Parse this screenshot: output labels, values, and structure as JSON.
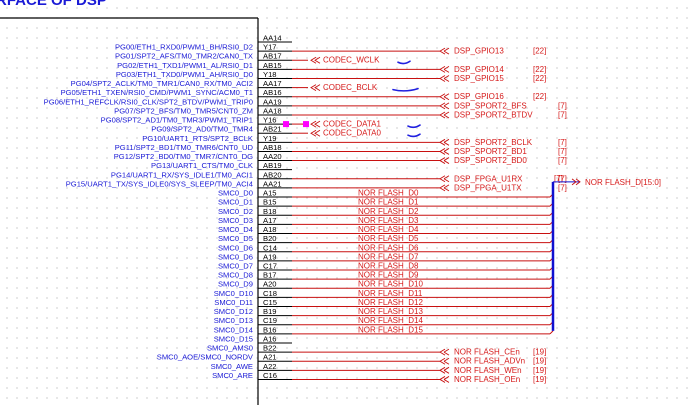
{
  "title": "RFACE OF DSP",
  "colors": {
    "pin_text": "#1a1ad6",
    "ball_text": "#000000",
    "net_text": "#d61a1a",
    "wire": "#c81010",
    "bus": "#1010d0",
    "pink_marker": "#ff00ff",
    "annotation": "#2020e0"
  },
  "pins": [
    {
      "name": "",
      "ball": "AA14",
      "net": "",
      "ref": ""
    },
    {
      "name": "PG00/ETH1_RXD0/PWM1_BH/RSI0_D2",
      "ball": "Y17",
      "net": "DSP_GPIO13",
      "ref": "[22]"
    },
    {
      "name": "PG01/SPT2_AFS/TM0_TMR2/CAN0_TX",
      "ball": "AB17",
      "net": "CODEC_WCLK",
      "ref": ""
    },
    {
      "name": "PG02/ETH1_TXD1/PWM1_AL/RSI0_D1",
      "ball": "AB15",
      "net": "DSP_GPIO14",
      "ref": "[22]"
    },
    {
      "name": "PG03/ETH1_TXD0/PWM1_AH/RSI0_D0",
      "ball": "Y18",
      "net": "DSP_GPIO15",
      "ref": "[22]"
    },
    {
      "name": "PG04/SPT2_ACLK/TM0_TMR1/CAN0_RX/TM0_ACI2",
      "ball": "AA17",
      "net": "CODEC_BCLK",
      "ref": ""
    },
    {
      "name": "PG05/ETH1_TXEN/RSI0_CMD/PWM1_SYNC/ACM0_T1",
      "ball": "AB16",
      "net": "DSP_GPIO16",
      "ref": "[22]"
    },
    {
      "name": "PG06/ETH1_REFCLK/RSI0_CLK/SPT2_BTDV/PWM1_TRIP0",
      "ball": "AA19",
      "net": "DSP_SPORT2_BFS",
      "ref": "[7]"
    },
    {
      "name": "PG07/SPT2_BFS/TM0_TMR5/CNT0_ZM",
      "ball": "AA18",
      "net": "DSP_SPORT2_BTDV",
      "ref": "[7]"
    },
    {
      "name": "PG08/SPT2_AD1/TM0_TMR3/PWM1_TRIP1",
      "ball": "Y16",
      "net": "CODEC_DATA1",
      "ref": ""
    },
    {
      "name": "PG09/SPT2_AD0/TM0_TMR4",
      "ball": "AB21",
      "net": "CODEC_DATA0",
      "ref": ""
    },
    {
      "name": "PG10/UART1_RTS/SPT2_BCLK",
      "ball": "Y19",
      "net": "DSP_SPORT2_BCLK",
      "ref": "[7]"
    },
    {
      "name": "PG11/SPT2_BD1/TM0_TMR6/CNT0_UD",
      "ball": "AB18",
      "net": "DSP_SPORT2_BD1",
      "ref": "[7]"
    },
    {
      "name": "PG12/SPT2_BD0/TM0_TMR7/CNT0_DG",
      "ball": "AA20",
      "net": "DSP_SPORT2_BD0",
      "ref": "[7]"
    },
    {
      "name": "PG13/UART1_CTS/TM0_CLK",
      "ball": "AB19",
      "net": "",
      "ref": ""
    },
    {
      "name": "PG14/UART1_RX/SYS_IDLE1/TM0_ACI1",
      "ball": "AB20",
      "net": "DSP_FPGA_U1RX",
      "ref": "[7]"
    },
    {
      "name": "PG15/UART1_TX/SYS_IDLE0/SYS_SLEEP/TM0_ACI4",
      "ball": "AA21",
      "net": "DSP_FPGA_U1TX",
      "ref": "[7]"
    },
    {
      "name": "SMC0_D0",
      "ball": "A15",
      "net": "NOR FLASH_D0",
      "ref": ""
    },
    {
      "name": "SMC0_D1",
      "ball": "B15",
      "net": "NOR FLASH_D1",
      "ref": ""
    },
    {
      "name": "SMC0_D2",
      "ball": "B18",
      "net": "NOR FLASH_D2",
      "ref": ""
    },
    {
      "name": "SMC0_D3",
      "ball": "A17",
      "net": "NOR FLASH_D3",
      "ref": ""
    },
    {
      "name": "SMC0_D4",
      "ball": "A18",
      "net": "NOR FLASH_D4",
      "ref": ""
    },
    {
      "name": "SMC0_D5",
      "ball": "B20",
      "net": "NOR FLASH_D5",
      "ref": ""
    },
    {
      "name": "SMC0_D6",
      "ball": "C14",
      "net": "NOR FLASH_D6",
      "ref": ""
    },
    {
      "name": "SMC0_D6",
      "ball": "A19",
      "net": "NOR FLASH_D7",
      "ref": ""
    },
    {
      "name": "SMC0_D7",
      "ball": "C17",
      "net": "NOR FLASH_D8",
      "ref": ""
    },
    {
      "name": "SMC0_D8",
      "ball": "B17",
      "net": "NOR FLASH_D9",
      "ref": ""
    },
    {
      "name": "SMC0_D9",
      "ball": "A20",
      "net": "NOR FLASH_D10",
      "ref": ""
    },
    {
      "name": "SMC0_D10",
      "ball": "C18",
      "net": "NOR FLASH_D11",
      "ref": ""
    },
    {
      "name": "SMC0_D11",
      "ball": "C15",
      "net": "NOR FLASH_D12",
      "ref": ""
    },
    {
      "name": "SMC0_D12",
      "ball": "B19",
      "net": "NOR FLASH_D13",
      "ref": ""
    },
    {
      "name": "SMC0_D13",
      "ball": "C19",
      "net": "NOR FLASH_D14",
      "ref": ""
    },
    {
      "name": "SMC0_D14",
      "ball": "B16",
      "net": "NOR FLASH_D15",
      "ref": ""
    },
    {
      "name": "SMC0_D15",
      "ball": "A16",
      "net": "",
      "ref": ""
    },
    {
      "name": "SMC0_AMS0",
      "ball": "B22",
      "net": "NOR FLASH_CEn",
      "ref": "[19]"
    },
    {
      "name": "SMC0_AOE/SMC0_NORDV",
      "ball": "A21",
      "net": "NOR FLASH_ADVn",
      "ref": "[19]"
    },
    {
      "name": "SMC0_AWE",
      "ball": "A22",
      "net": "NOR FLASH_WEn",
      "ref": "[19]"
    },
    {
      "name": "SMC0_ARE",
      "ball": "C16",
      "net": "NOR FLASH_OEn",
      "ref": "[19]"
    }
  ],
  "bus": {
    "label": "NOR FLASH_D[15:0]",
    "ref": "[7]"
  }
}
